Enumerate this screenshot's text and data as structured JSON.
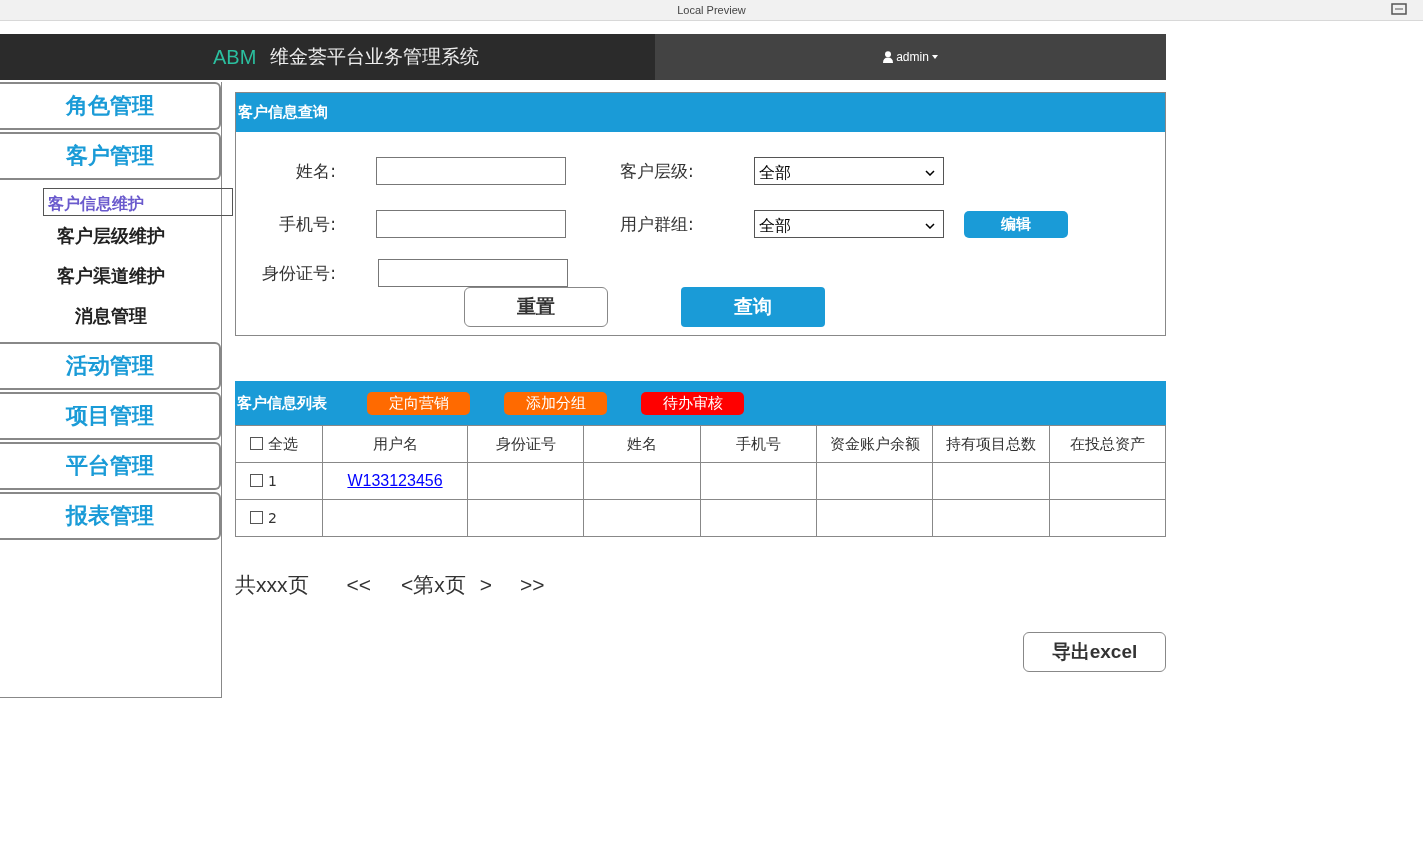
{
  "browser": {
    "title": "Local Preview"
  },
  "header": {
    "logo": "ABM",
    "title": "维金荟平台业务管理系统",
    "user": "admin"
  },
  "sidebar": {
    "items": [
      {
        "label": "角色管理"
      },
      {
        "label": "客户管理",
        "children": [
          {
            "label": "客户信息维护",
            "selected": true
          },
          {
            "label": "客户层级维护",
            "selected": false
          },
          {
            "label": "客户渠道维护",
            "selected": false
          },
          {
            "label": "消息管理",
            "selected": false
          }
        ]
      },
      {
        "label": "活动管理"
      },
      {
        "label": "项目管理"
      },
      {
        "label": "平台管理"
      },
      {
        "label": "报表管理"
      }
    ]
  },
  "query": {
    "title": "客户信息查询",
    "name_label": "姓名:",
    "level_label": "客户层级:",
    "level_value": "全部",
    "phone_label": "手机号:",
    "group_label": "用户群组:",
    "group_value": "全部",
    "edit": "编辑",
    "id_label": "身份证号:",
    "reset": "重置",
    "search": "查询"
  },
  "list": {
    "title": "客户信息列表",
    "actions": [
      {
        "label": "定向营销",
        "color": "#ff6a00"
      },
      {
        "label": "添加分组",
        "color": "#ff6a00"
      },
      {
        "label": "待办审核",
        "color": "#ff0000"
      }
    ],
    "select_all": {
      "label": "全选",
      "checked": false
    },
    "columns": [
      "用户名",
      "身份证号",
      "姓名",
      "手机号",
      "资金账户余额",
      "持有项目总数",
      "在投总资产"
    ],
    "rows": [
      {
        "index": "1",
        "checked": false,
        "username": "W133123456"
      },
      {
        "index": "2",
        "checked": false
      }
    ]
  },
  "pagination": {
    "total": "共xxx页",
    "first": "<<",
    "current": "<第x页",
    "next": ">",
    "last": ">>"
  },
  "export": "导出excel"
}
